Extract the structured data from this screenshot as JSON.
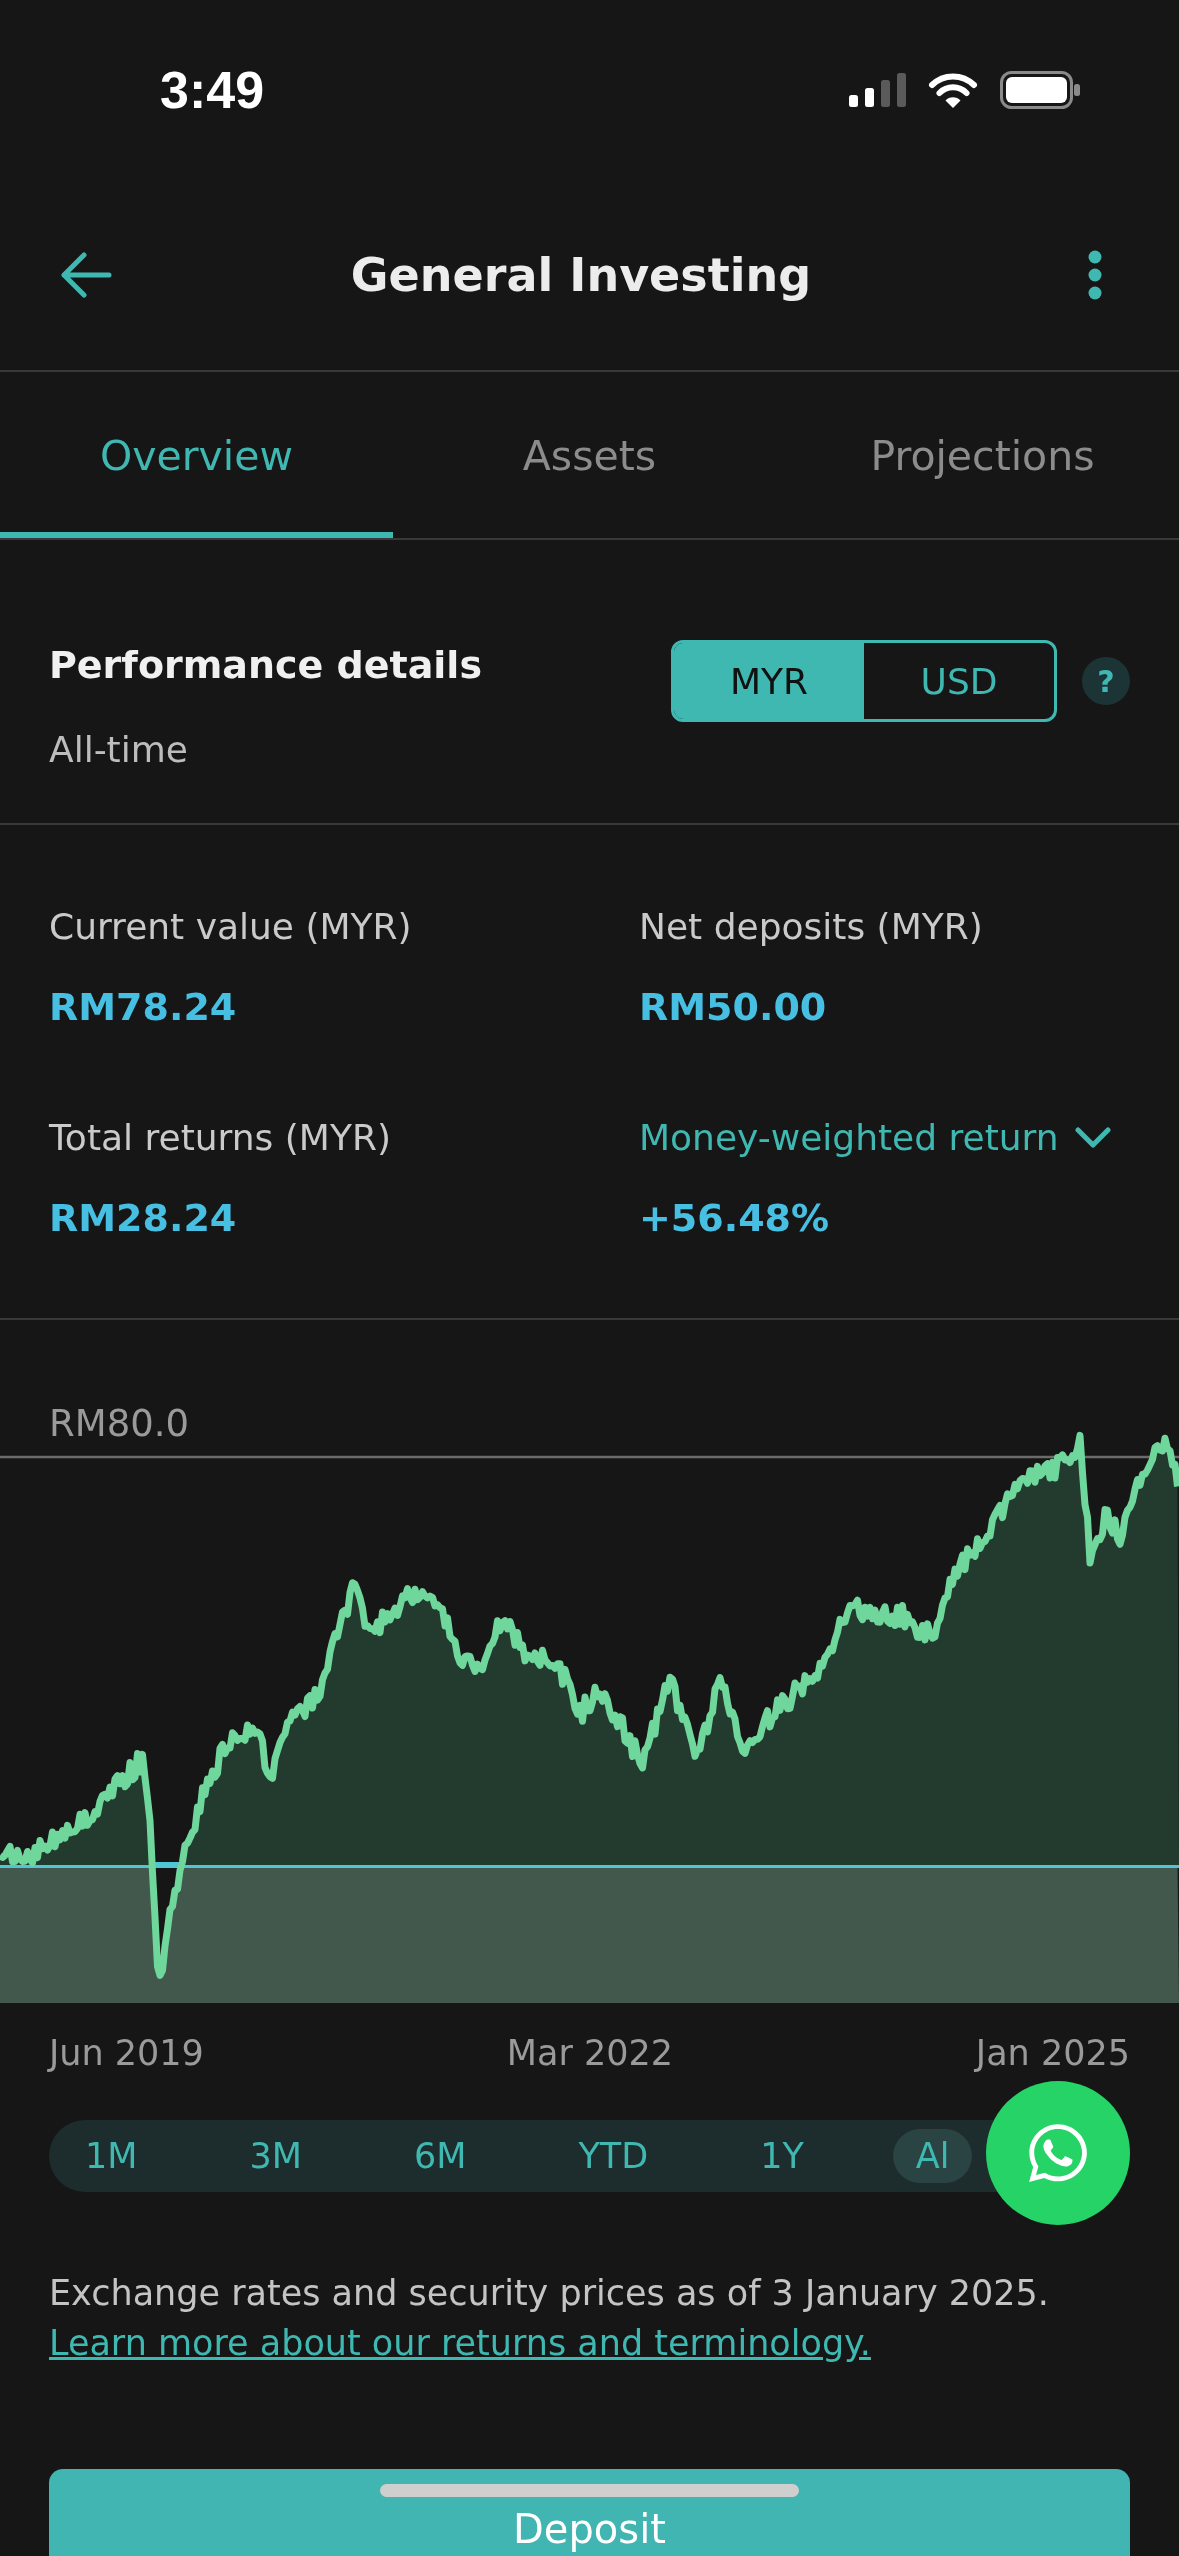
{
  "status_bar": {
    "time": "3:49"
  },
  "header": {
    "title": "General Investing"
  },
  "tabs": [
    {
      "label": "Overview",
      "selected": true
    },
    {
      "label": "Assets",
      "selected": false
    },
    {
      "label": "Projections",
      "selected": false
    }
  ],
  "performance": {
    "title": "Performance details",
    "period": "All-time",
    "currencies": [
      {
        "label": "MYR",
        "selected": true
      },
      {
        "label": "USD",
        "selected": false
      }
    ],
    "help": "?"
  },
  "stats": [
    {
      "kind": "plain",
      "label": "Current value (MYR)",
      "value": "RM78.24"
    },
    {
      "kind": "plain",
      "label": "Net deposits (MYR)",
      "value": "RM50.00"
    },
    {
      "kind": "plain",
      "label": "Total returns (MYR)",
      "value": "RM28.24"
    },
    {
      "kind": "dropdown",
      "label": "Money-weighted return",
      "value": "+56.48%"
    }
  ],
  "chart": {
    "top_label": "RM80.0",
    "x_labels": [
      "Jun 2019",
      "Mar 2022",
      "Jan 2025"
    ]
  },
  "ranges": [
    {
      "label": "1M",
      "selected": false
    },
    {
      "label": "3M",
      "selected": false
    },
    {
      "label": "6M",
      "selected": false
    },
    {
      "label": "YTD",
      "selected": false
    },
    {
      "label": "1Y",
      "selected": false
    },
    {
      "label": "Al",
      "selected": true
    }
  ],
  "note": "Exchange rates and security prices as of 3 January 2025.",
  "link": "Learn more about our returns and terminology.",
  "deposit_button": "Deposit"
}
